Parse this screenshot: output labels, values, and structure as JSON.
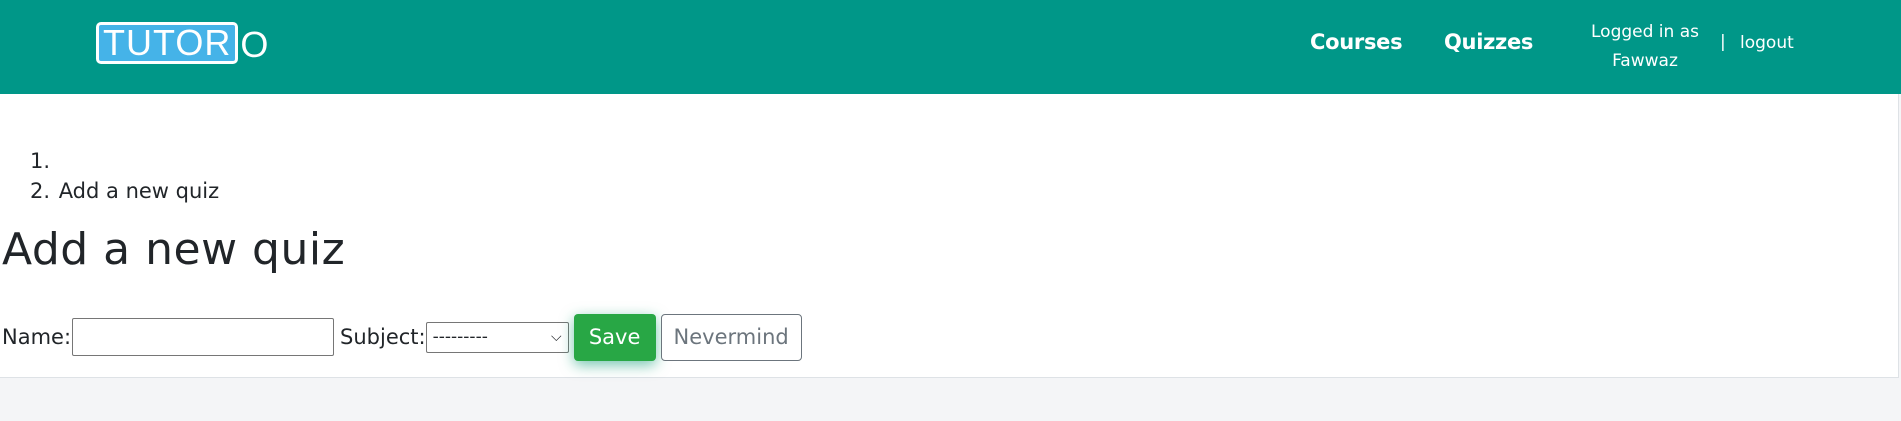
{
  "header": {
    "logo": {
      "boxed_text": "TUTOR",
      "tail_text": "O"
    },
    "nav": {
      "courses": "Courses",
      "quizzes": "Quizzes"
    },
    "user": {
      "line1": "Logged in as",
      "line2": "Fawwaz",
      "separator": "|",
      "logout": "logout"
    },
    "colors": {
      "background": "#009788",
      "logo_fill": "#45b3e8"
    }
  },
  "breadcrumb": {
    "items": [
      {
        "num": "1.",
        "label": ""
      },
      {
        "num": "2.",
        "label": "Add a new quiz"
      }
    ]
  },
  "page": {
    "title": "Add a new quiz"
  },
  "form": {
    "name_label": "Name:",
    "name_value": "",
    "subject_label": "Subject:",
    "subject_selected": "---------",
    "save_label": "Save",
    "cancel_label": "Nevermind",
    "colors": {
      "save": "#28a745",
      "cancel_border": "#6c757d"
    }
  }
}
